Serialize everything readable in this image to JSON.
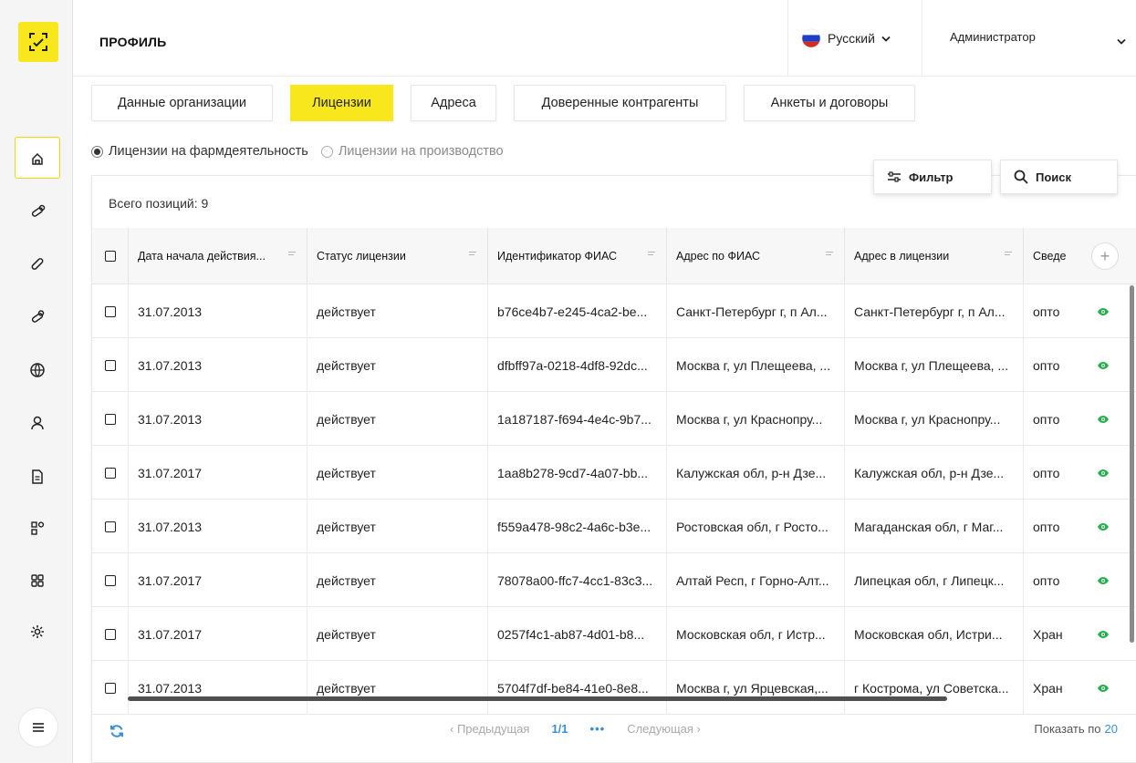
{
  "app": {
    "page_title": "ПРОФИЛЬ",
    "language": "Русский",
    "user": "Администратор"
  },
  "colors": {
    "accent": "#f8e71c",
    "link": "#3a8fd9",
    "eye": "#22b14c"
  },
  "sidebar": {
    "items": [
      {
        "icon": "home-icon",
        "active": true
      },
      {
        "icon": "pills-icon",
        "active": false
      },
      {
        "icon": "capsule-icon",
        "active": false
      },
      {
        "icon": "pills-alt-icon",
        "active": false
      },
      {
        "icon": "globe-icon",
        "active": false
      },
      {
        "icon": "user-icon",
        "active": false
      },
      {
        "icon": "document-icon",
        "active": false
      },
      {
        "icon": "modules-icon",
        "active": false
      },
      {
        "icon": "grid-icon",
        "active": false
      },
      {
        "icon": "settings-icon",
        "active": false
      }
    ]
  },
  "tabs": [
    {
      "label": "Данные организации",
      "active": false
    },
    {
      "label": "Лицензии",
      "active": true
    },
    {
      "label": "Адреса",
      "active": false
    },
    {
      "label": "Доверенные контрагенты",
      "active": false
    },
    {
      "label": "Анкеты и договоры",
      "active": false
    }
  ],
  "radios": [
    {
      "label": "Лицензии на фармдеятельность",
      "checked": true
    },
    {
      "label": "Лицензии на производство",
      "checked": false
    }
  ],
  "tools": {
    "filter_label": "Фильтр",
    "search_label": "Поиск"
  },
  "table": {
    "total": "Всего позиций: 9",
    "columns": [
      "Дата начала действия...",
      "Статус лицензии",
      "Идентификатор ФИАС",
      "Адрес по ФИАС",
      "Адрес в лицензии",
      "Сведе"
    ],
    "rows": [
      [
        "31.07.2013",
        "действует",
        "b76ce4b7-e245-4ca2-be...",
        "Санкт-Петербург г, п Ал...",
        "Санкт-Петербург г, п Ал...",
        "опто"
      ],
      [
        "31.07.2013",
        "действует",
        "dfbff97a-0218-4df8-92dc...",
        "Москва г, ул Плещеева, ...",
        "Москва г, ул Плещеева, ...",
        "опто"
      ],
      [
        "31.07.2013",
        "действует",
        "1a187187-f694-4e4c-9b7...",
        "Москва г, ул Краснопру...",
        "Москва г, ул Краснопру...",
        "опто"
      ],
      [
        "31.07.2017",
        "действует",
        "1aa8b278-9cd7-4a07-bb...",
        "Калужская обл, р-н Дзе...",
        "Калужская обл, р-н Дзе...",
        "опто"
      ],
      [
        "31.07.2013",
        "действует",
        "f559a478-98c2-4a6c-b3e...",
        "Ростовская обл, г Росто...",
        "Магаданская обл, г Маг...",
        "опто"
      ],
      [
        "31.07.2017",
        "действует",
        "78078a00-ffc7-4cc1-83c3...",
        "Алтай Респ, г Горно-Алт...",
        "Липецкая обл, г Липецк...",
        "опто"
      ],
      [
        "31.07.2017",
        "действует",
        "0257f4c1-ab87-4d01-b8...",
        "Московская обл, г Истр...",
        "Московская обл, Истри...",
        "Хран"
      ],
      [
        "31.07.2013",
        "действует",
        "5704f7df-be84-41e0-8e8...",
        "Москва г, ул Ярцевская,...",
        "г Кострома, ул Советска...",
        "Хран"
      ]
    ]
  },
  "pagination": {
    "prev": "Предыдущая",
    "current": "1/1",
    "more": "•••",
    "next": "Следующая",
    "show_by_label": "Показать по",
    "show_by_value": "20"
  }
}
